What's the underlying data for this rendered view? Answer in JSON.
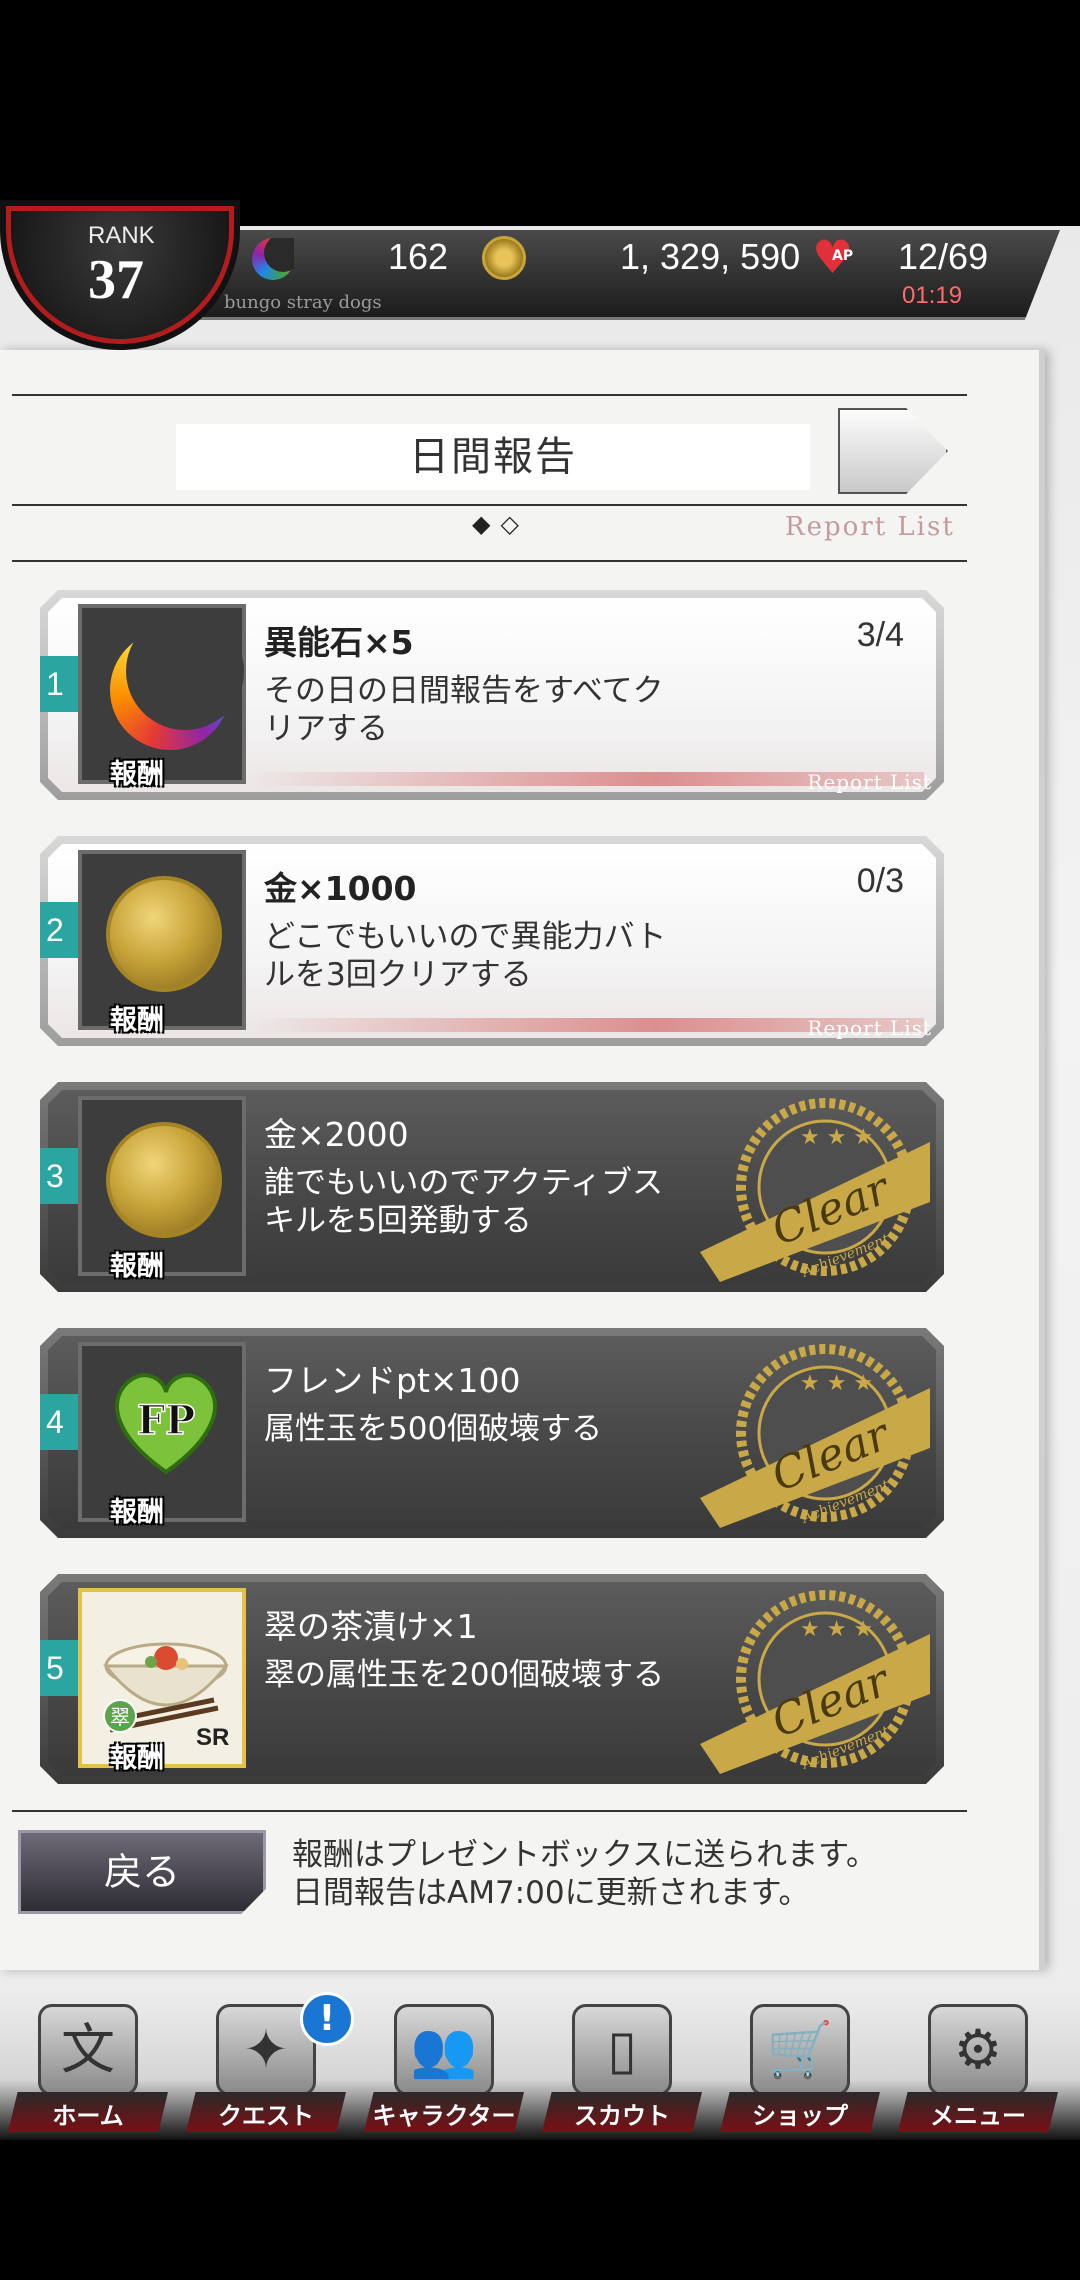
{
  "status_bar": {
    "rank_label": "RANK",
    "rank_value": "37",
    "stones": "162",
    "gold": "1, 329, 590",
    "ap_label": "AP",
    "ap": "12/69",
    "ap_timer": "01:19",
    "subtitle": "bungo stray dogs",
    "timer_color": "#ff6b6b"
  },
  "header": {
    "title": "日間報告",
    "page_indicator": "◆◇",
    "report_list_link": "Report List"
  },
  "missions": [
    {
      "number": "1",
      "reward_name": "異能石×5",
      "progress": "3/4",
      "description_lines": [
        "その日の日間報告をすべてク",
        "リアする"
      ],
      "reward_tag": "報酬",
      "report_list": "Report List",
      "icon": "crescent-stone-icon",
      "cleared": false
    },
    {
      "number": "2",
      "reward_name": "金×1000",
      "progress": "0/3",
      "description_lines": [
        "どこでもいいので異能力バト",
        "ルを3回クリアする"
      ],
      "reward_tag": "報酬",
      "report_list": "Report List",
      "icon": "gold-coin-icon",
      "cleared": false
    },
    {
      "number": "3",
      "reward_name": "金×2000",
      "description_lines": [
        "誰でもいいのでアクティブス",
        "キルを5回発動する"
      ],
      "reward_tag": "報酬",
      "icon": "gold-coin-icon",
      "cleared": true,
      "stamp_text": "Clear",
      "stamp_sub": "Achievement"
    },
    {
      "number": "4",
      "reward_name": "フレンドpt×100",
      "description_lines": [
        "属性玉を500個破壊する"
      ],
      "reward_tag": "報酬",
      "icon": "friend-point-icon",
      "icon_text": "FP",
      "cleared": true,
      "stamp_text": "Clear",
      "stamp_sub": "Achievement"
    },
    {
      "number": "5",
      "reward_name": "翠の茶漬け×1",
      "description_lines": [
        "翠の属性玉を200個破壊する"
      ],
      "reward_tag": "報酬",
      "icon": "chazuke-item-icon",
      "rarity": "SR",
      "element_badge": "翠",
      "cleared": true,
      "stamp_text": "Clear",
      "stamp_sub": "Achievement"
    }
  ],
  "footer": {
    "back_label": "戻る",
    "note_lines": [
      "報酬はプレゼントボックスに送られます。",
      "日間報告はAM7:00に更新されます。"
    ]
  },
  "nav": {
    "items": [
      {
        "label": "ホーム",
        "icon": "home-icon",
        "glyph": "文"
      },
      {
        "label": "クエスト",
        "icon": "quest-icon",
        "glyph": "✦"
      },
      {
        "label": "キャラクター",
        "icon": "characters-icon",
        "glyph": "👥"
      },
      {
        "label": "スカウト",
        "icon": "scout-icon",
        "glyph": "▯"
      },
      {
        "label": "ショップ",
        "icon": "shop-icon",
        "glyph": "🛒"
      },
      {
        "label": "メニュー",
        "icon": "menu-gear-icon",
        "glyph": "⚙"
      }
    ],
    "quest_alert": "!"
  },
  "colors": {
    "accent_teal": "#2aa5a0",
    "stamp_gold": "#c9a848",
    "nav_red": "#7a0f14"
  }
}
